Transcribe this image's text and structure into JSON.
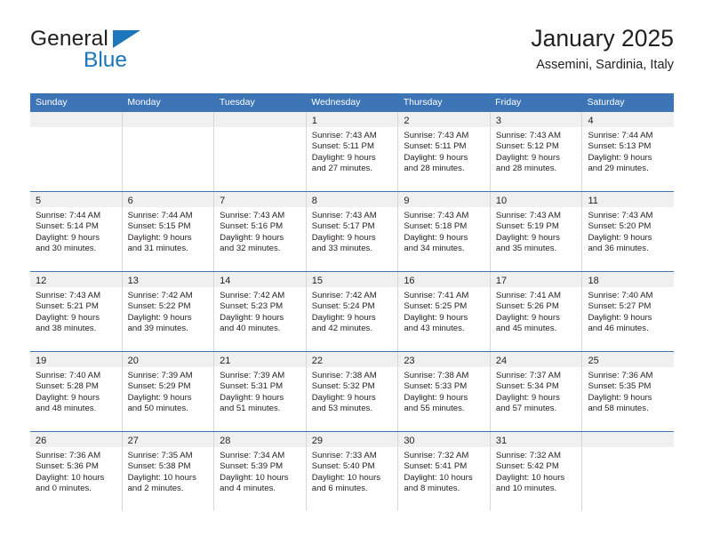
{
  "logo": {
    "word_top": "General",
    "word_bottom": "Blue",
    "triangle_color": "#1b76bc",
    "text_color": "#231f20"
  },
  "header": {
    "title": "January 2025",
    "subtitle": "Assemini, Sardinia, Italy"
  },
  "theme": {
    "header_blue": "#3c74b5",
    "daynum_band": "#f0f0f0",
    "cell_border": "#d7d7d7",
    "text": "#231f20"
  },
  "weekdays": [
    "Sunday",
    "Monday",
    "Tuesday",
    "Wednesday",
    "Thursday",
    "Friday",
    "Saturday"
  ],
  "weeks": [
    [
      {
        "day": "",
        "lines": []
      },
      {
        "day": "",
        "lines": []
      },
      {
        "day": "",
        "lines": []
      },
      {
        "day": "1",
        "lines": [
          "Sunrise: 7:43 AM",
          "Sunset: 5:11 PM",
          "Daylight: 9 hours",
          "and 27 minutes."
        ]
      },
      {
        "day": "2",
        "lines": [
          "Sunrise: 7:43 AM",
          "Sunset: 5:11 PM",
          "Daylight: 9 hours",
          "and 28 minutes."
        ]
      },
      {
        "day": "3",
        "lines": [
          "Sunrise: 7:43 AM",
          "Sunset: 5:12 PM",
          "Daylight: 9 hours",
          "and 28 minutes."
        ]
      },
      {
        "day": "4",
        "lines": [
          "Sunrise: 7:44 AM",
          "Sunset: 5:13 PM",
          "Daylight: 9 hours",
          "and 29 minutes."
        ]
      }
    ],
    [
      {
        "day": "5",
        "lines": [
          "Sunrise: 7:44 AM",
          "Sunset: 5:14 PM",
          "Daylight: 9 hours",
          "and 30 minutes."
        ]
      },
      {
        "day": "6",
        "lines": [
          "Sunrise: 7:44 AM",
          "Sunset: 5:15 PM",
          "Daylight: 9 hours",
          "and 31 minutes."
        ]
      },
      {
        "day": "7",
        "lines": [
          "Sunrise: 7:43 AM",
          "Sunset: 5:16 PM",
          "Daylight: 9 hours",
          "and 32 minutes."
        ]
      },
      {
        "day": "8",
        "lines": [
          "Sunrise: 7:43 AM",
          "Sunset: 5:17 PM",
          "Daylight: 9 hours",
          "and 33 minutes."
        ]
      },
      {
        "day": "9",
        "lines": [
          "Sunrise: 7:43 AM",
          "Sunset: 5:18 PM",
          "Daylight: 9 hours",
          "and 34 minutes."
        ]
      },
      {
        "day": "10",
        "lines": [
          "Sunrise: 7:43 AM",
          "Sunset: 5:19 PM",
          "Daylight: 9 hours",
          "and 35 minutes."
        ]
      },
      {
        "day": "11",
        "lines": [
          "Sunrise: 7:43 AM",
          "Sunset: 5:20 PM",
          "Daylight: 9 hours",
          "and 36 minutes."
        ]
      }
    ],
    [
      {
        "day": "12",
        "lines": [
          "Sunrise: 7:43 AM",
          "Sunset: 5:21 PM",
          "Daylight: 9 hours",
          "and 38 minutes."
        ]
      },
      {
        "day": "13",
        "lines": [
          "Sunrise: 7:42 AM",
          "Sunset: 5:22 PM",
          "Daylight: 9 hours",
          "and 39 minutes."
        ]
      },
      {
        "day": "14",
        "lines": [
          "Sunrise: 7:42 AM",
          "Sunset: 5:23 PM",
          "Daylight: 9 hours",
          "and 40 minutes."
        ]
      },
      {
        "day": "15",
        "lines": [
          "Sunrise: 7:42 AM",
          "Sunset: 5:24 PM",
          "Daylight: 9 hours",
          "and 42 minutes."
        ]
      },
      {
        "day": "16",
        "lines": [
          "Sunrise: 7:41 AM",
          "Sunset: 5:25 PM",
          "Daylight: 9 hours",
          "and 43 minutes."
        ]
      },
      {
        "day": "17",
        "lines": [
          "Sunrise: 7:41 AM",
          "Sunset: 5:26 PM",
          "Daylight: 9 hours",
          "and 45 minutes."
        ]
      },
      {
        "day": "18",
        "lines": [
          "Sunrise: 7:40 AM",
          "Sunset: 5:27 PM",
          "Daylight: 9 hours",
          "and 46 minutes."
        ]
      }
    ],
    [
      {
        "day": "19",
        "lines": [
          "Sunrise: 7:40 AM",
          "Sunset: 5:28 PM",
          "Daylight: 9 hours",
          "and 48 minutes."
        ]
      },
      {
        "day": "20",
        "lines": [
          "Sunrise: 7:39 AM",
          "Sunset: 5:29 PM",
          "Daylight: 9 hours",
          "and 50 minutes."
        ]
      },
      {
        "day": "21",
        "lines": [
          "Sunrise: 7:39 AM",
          "Sunset: 5:31 PM",
          "Daylight: 9 hours",
          "and 51 minutes."
        ]
      },
      {
        "day": "22",
        "lines": [
          "Sunrise: 7:38 AM",
          "Sunset: 5:32 PM",
          "Daylight: 9 hours",
          "and 53 minutes."
        ]
      },
      {
        "day": "23",
        "lines": [
          "Sunrise: 7:38 AM",
          "Sunset: 5:33 PM",
          "Daylight: 9 hours",
          "and 55 minutes."
        ]
      },
      {
        "day": "24",
        "lines": [
          "Sunrise: 7:37 AM",
          "Sunset: 5:34 PM",
          "Daylight: 9 hours",
          "and 57 minutes."
        ]
      },
      {
        "day": "25",
        "lines": [
          "Sunrise: 7:36 AM",
          "Sunset: 5:35 PM",
          "Daylight: 9 hours",
          "and 58 minutes."
        ]
      }
    ],
    [
      {
        "day": "26",
        "lines": [
          "Sunrise: 7:36 AM",
          "Sunset: 5:36 PM",
          "Daylight: 10 hours",
          "and 0 minutes."
        ]
      },
      {
        "day": "27",
        "lines": [
          "Sunrise: 7:35 AM",
          "Sunset: 5:38 PM",
          "Daylight: 10 hours",
          "and 2 minutes."
        ]
      },
      {
        "day": "28",
        "lines": [
          "Sunrise: 7:34 AM",
          "Sunset: 5:39 PM",
          "Daylight: 10 hours",
          "and 4 minutes."
        ]
      },
      {
        "day": "29",
        "lines": [
          "Sunrise: 7:33 AM",
          "Sunset: 5:40 PM",
          "Daylight: 10 hours",
          "and 6 minutes."
        ]
      },
      {
        "day": "30",
        "lines": [
          "Sunrise: 7:32 AM",
          "Sunset: 5:41 PM",
          "Daylight: 10 hours",
          "and 8 minutes."
        ]
      },
      {
        "day": "31",
        "lines": [
          "Sunrise: 7:32 AM",
          "Sunset: 5:42 PM",
          "Daylight: 10 hours",
          "and 10 minutes."
        ]
      },
      {
        "day": "",
        "lines": []
      }
    ]
  ]
}
